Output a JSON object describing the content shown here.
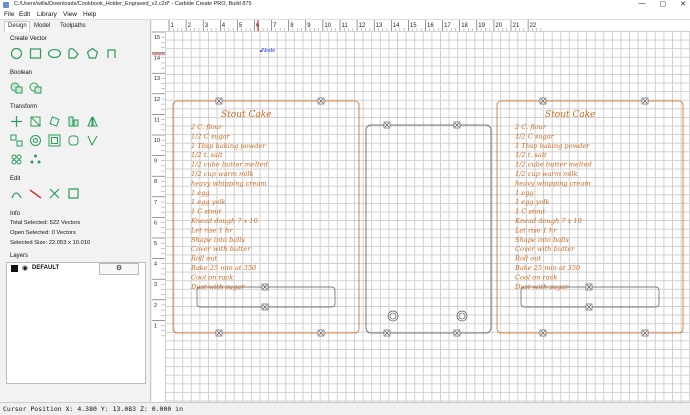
{
  "window": {
    "title": "C:/Users/willa/Downloads/Cookbook_Holder_Engraved_v2.c2d* - Carbide Create PRO, Build 875",
    "controls": [
      "—",
      "▢",
      "✕"
    ]
  },
  "menu": [
    "File",
    "Edit",
    "Library",
    "View",
    "Help"
  ],
  "tabs": [
    "Design",
    "Model",
    "Toolpaths"
  ],
  "sections": {
    "create_vector": "Create Vector",
    "boolean": "Boolean",
    "transform": "Transform",
    "edit": "Edit",
    "info": "Info",
    "layers": "Layers"
  },
  "info": {
    "total_selected_label": "Total Selected:",
    "total_selected_value": "522 Vectors",
    "open_selected_label": "Open Selected:",
    "open_selected_value": "0 Vectors",
    "selected_size_label": "Selected Size:",
    "selected_size_value": "22.053 x 10.010"
  },
  "layers": {
    "name": "DEFAULT",
    "color": "#000000"
  },
  "ruler_top_labels": [
    "1",
    "2",
    "3",
    "4",
    "5",
    "6",
    "7",
    "8",
    "9",
    "10",
    "11",
    "12",
    "13",
    "14",
    "15",
    "16",
    "17",
    "18",
    "19",
    "20",
    "21",
    "22"
  ],
  "ruler_left_labels": [
    "15",
    "14",
    "13",
    "12",
    "11",
    "10",
    "9",
    "8",
    "7",
    "6",
    "5",
    "4",
    "3",
    "2",
    "1"
  ],
  "canvas": {
    "node_label": "Node",
    "recipe_title": "Stout Cake",
    "recipe_lines": [
      "2 C. flour",
      "1/2 C sugar",
      "1 Tbsp baking powder",
      "1/2 t. salt",
      "1/2 cube butter melted",
      "1/2 cup warm milk",
      "heavy whipping cream",
      "1 egg",
      "1 egg yolk",
      "1 C stout",
      "Knead dough 7 x 10",
      "Let rise 1 hr",
      "Shape into balls",
      "Cover with butter",
      "Roll out",
      "Bake 25 min at 350",
      "Cool on rack",
      "Dust with sugar"
    ],
    "vector_color": "#d2691e"
  },
  "status": {
    "cursor_position": "Cursor Position X: 4.380 Y: 13.083 Z: 0.000 in"
  }
}
